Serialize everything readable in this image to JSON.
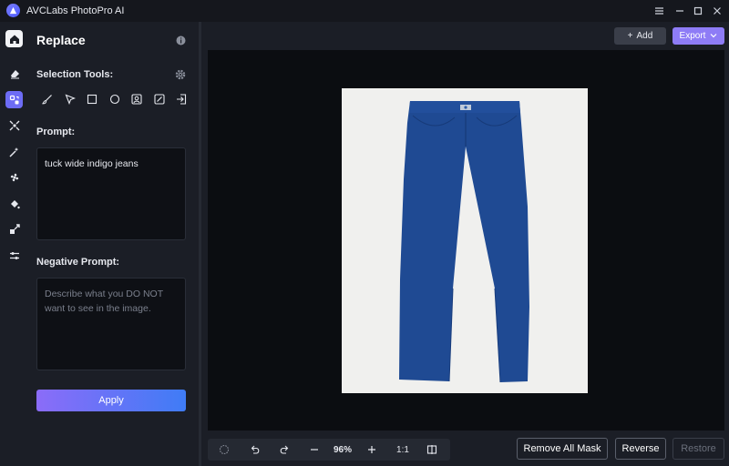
{
  "app": {
    "title": "AVCLabs PhotoPro AI"
  },
  "panel": {
    "title": "Replace",
    "selection_tools_label": "Selection Tools:",
    "prompt_label": "Prompt:",
    "prompt_value": "tuck wide indigo jeans",
    "negative_prompt_label": "Negative Prompt:",
    "negative_prompt_placeholder": "Describe what you DO NOT want to see in the image.",
    "apply_label": "Apply"
  },
  "topbar": {
    "add_label": "Add",
    "export_label": "Export"
  },
  "bottom": {
    "zoom_value": "96%",
    "ratio_label": "1:1",
    "remove_all_mask_label": "Remove All Mask",
    "reverse_label": "Reverse",
    "restore_label": "Restore"
  },
  "colors": {
    "accent": "#6d6cf5",
    "export_button": "#8e7cf6",
    "apply_gradient_start": "#8b6cf8",
    "apply_gradient_end": "#3f7cf6",
    "jeans": "#1f4a93"
  }
}
